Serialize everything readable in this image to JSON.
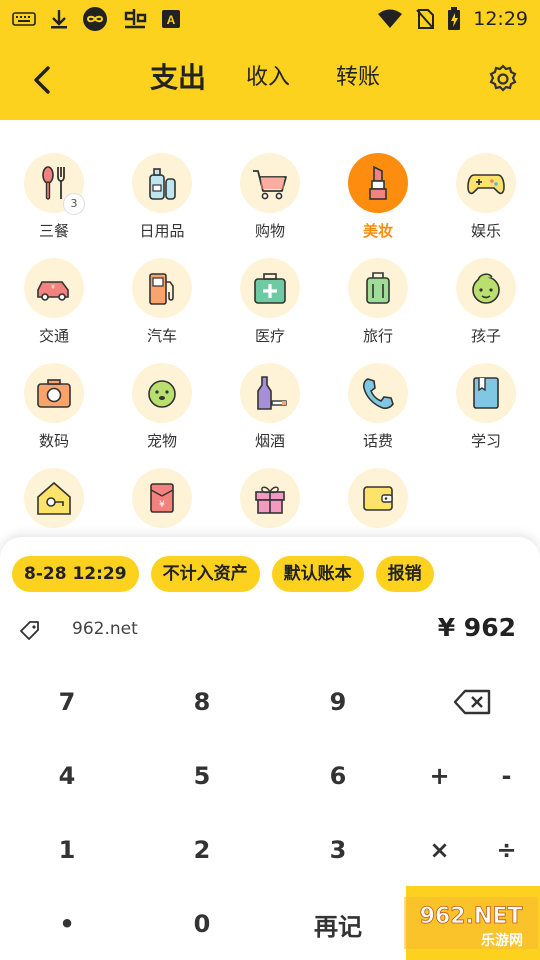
{
  "status_bar": {
    "time": "12:29",
    "left_icons": [
      "keyboard-icon",
      "download-icon",
      "infinity-icon",
      "app-icon",
      "a-icon"
    ],
    "right_icons": [
      "wifi-icon",
      "no-sim-icon",
      "battery-icon"
    ]
  },
  "header": {
    "tabs": [
      {
        "label": "支出",
        "active": true
      },
      {
        "label": "收入",
        "active": false
      },
      {
        "label": "转账",
        "active": false
      }
    ],
    "back_icon": "back-arrow-icon",
    "settings_icon": "gear-icon"
  },
  "categories": [
    {
      "label": "三餐",
      "icon": "fork-spoon-icon",
      "badge": "3"
    },
    {
      "label": "日用品",
      "icon": "bottles-icon"
    },
    {
      "label": "购物",
      "icon": "cart-icon"
    },
    {
      "label": "美妆",
      "icon": "lipstick-icon",
      "active": true
    },
    {
      "label": "娱乐",
      "icon": "gamepad-icon"
    },
    {
      "label": "交通",
      "icon": "car-icon"
    },
    {
      "label": "汽车",
      "icon": "fuel-pump-icon"
    },
    {
      "label": "医疗",
      "icon": "medkit-icon"
    },
    {
      "label": "旅行",
      "icon": "luggage-icon"
    },
    {
      "label": "孩子",
      "icon": "baby-icon"
    },
    {
      "label": "数码",
      "icon": "camera-icon"
    },
    {
      "label": "宠物",
      "icon": "dog-icon"
    },
    {
      "label": "烟酒",
      "icon": "bottle-cigarette-icon"
    },
    {
      "label": "话费",
      "icon": "phone-icon"
    },
    {
      "label": "学习",
      "icon": "book-icon"
    },
    {
      "label": "",
      "icon": "house-key-icon"
    },
    {
      "label": "",
      "icon": "red-envelope-icon"
    },
    {
      "label": "",
      "icon": "gift-icon"
    },
    {
      "label": "",
      "icon": "wallet-icon"
    }
  ],
  "chips": [
    "8-28 12:29",
    "不计入资产",
    "默认账本",
    "报销"
  ],
  "note": {
    "icon": "tag-icon",
    "text": "962.net"
  },
  "amount": "¥ 962",
  "keys": {
    "k7": "7",
    "k8": "8",
    "k9": "9",
    "k4": "4",
    "k5": "5",
    "k6": "6",
    "plus": "+",
    "minus": "-",
    "k1": "1",
    "k2": "2",
    "k3": "3",
    "times": "×",
    "divide": "÷",
    "dot": "•",
    "k0": "0",
    "again": "再记",
    "backspace_icon": "backspace-icon"
  },
  "watermark": {
    "text": "962.NET",
    "sub": "乐游网"
  },
  "colors": {
    "accent": "#fdd21f",
    "active": "#fd8d0f",
    "icon_bg": "#fef3d6"
  }
}
